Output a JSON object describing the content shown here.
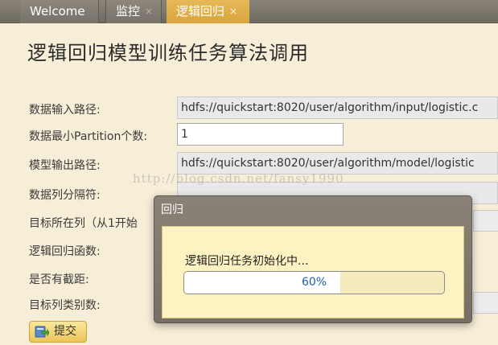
{
  "tabs": [
    {
      "label": "Welcome",
      "closable": false,
      "active": false
    },
    {
      "label": "监控",
      "closable": true,
      "active": false
    },
    {
      "label": "逻辑回归",
      "closable": true,
      "active": true
    }
  ],
  "tab_close_symbol": "×",
  "page_title": "逻辑回归模型训练任务算法调用",
  "form": {
    "input_path": {
      "label": "数据输入路径:",
      "value": "hdfs://quickstart:8020/user/algorithm/input/logistic.c"
    },
    "min_partitions": {
      "label": "数据最小Partition个数:",
      "value": "1"
    },
    "model_output_path": {
      "label": "模型输出路径:",
      "value": "hdfs://quickstart:8020/user/algorithm/model/logistic"
    },
    "column_separator": {
      "label": "数据列分隔符:",
      "value": ""
    },
    "target_column": {
      "label": "目标所在列（从1开始",
      "value": ""
    },
    "logistic_function": {
      "label": "逻辑回归函数:",
      "value": ""
    },
    "has_intercept": {
      "label": "是否有截距:",
      "value": ""
    },
    "target_classes": {
      "label": "目标列类别数:",
      "value": ""
    }
  },
  "submit_button": {
    "label": "提交",
    "icon": "submit-icon"
  },
  "watermark": "http://blog.csdn.net/fansy1990",
  "dialog": {
    "title": "回归",
    "message": "逻辑回归任务初始化中...",
    "progress_fraction": 0.6,
    "progress_label": "60%"
  },
  "colors": {
    "background": "#f7eed8",
    "tab_active": "#dcaa45",
    "dialog_body": "#fdf3c2",
    "progress_text": "#1f5fae"
  }
}
